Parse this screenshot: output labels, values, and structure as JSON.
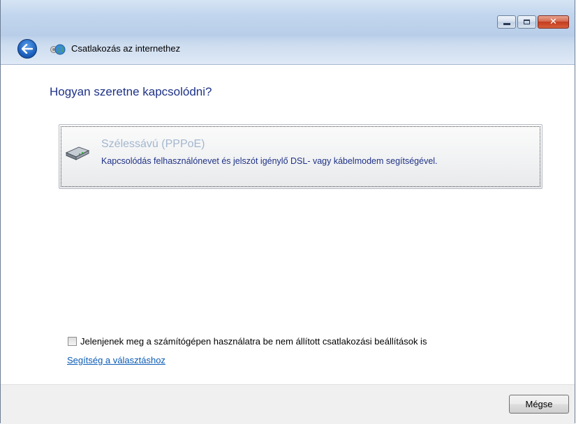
{
  "window": {
    "title": "Csatlakozás az internethez",
    "controls": [
      "minimize",
      "maximize",
      "close"
    ]
  },
  "heading": "Hogyan szeretne kapcsolódni?",
  "option": {
    "icon": "broadband-modem-icon",
    "title": "Szélessávú (PPPoE)",
    "description": "Kapcsolódás felhasználónevet és jelszót igénylő DSL- vagy kábelmodem segítségével."
  },
  "show_unconfigured": {
    "checked": false,
    "label": "Jelenjenek meg a számítógépen használatra be nem állított csatlakozási beállítások is"
  },
  "help_link": "Segítség a választáshoz",
  "footer": {
    "cancel_label": "Mégse"
  },
  "colors": {
    "heading": "#1e3287",
    "link": "#0b5bb6",
    "option_title_disabled": "#a3b6cd",
    "close_button": "#c23b1e"
  }
}
